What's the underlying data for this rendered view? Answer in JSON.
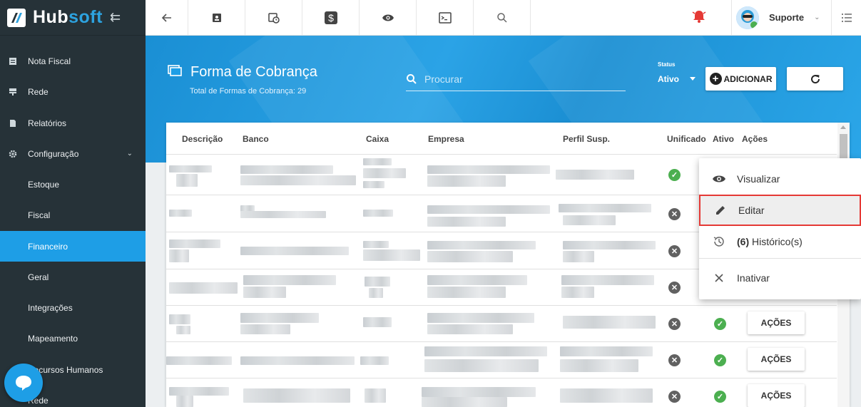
{
  "app": {
    "logo_word_a": "Hub",
    "logo_word_b": "soft"
  },
  "sidebar": {
    "items": [
      {
        "label": "Nota Fiscal",
        "icon": "document-icon"
      },
      {
        "label": "Rede",
        "icon": "network-icon"
      },
      {
        "label": "Relatórios",
        "icon": "report-icon"
      },
      {
        "label": "Configuração",
        "icon": "gear-icon"
      },
      {
        "label": "Estoque"
      },
      {
        "label": "Fiscal"
      },
      {
        "label": "Financeiro",
        "active": true
      },
      {
        "label": "Geral"
      },
      {
        "label": "Integrações"
      },
      {
        "label": "Mapeamento"
      },
      {
        "label": "Recursos Humanos"
      },
      {
        "label": "Rede"
      }
    ]
  },
  "topbar": {
    "user_name": "Suporte"
  },
  "header": {
    "title": "Forma de Cobrança",
    "subtitle": "Total de Formas de Cobrança: 29",
    "search_placeholder": "Procurar",
    "status_label": "Status",
    "status_value": "Ativo",
    "add_label": "ADICIONAR"
  },
  "table": {
    "columns": [
      "Descrição",
      "Banco",
      "Caixa",
      "Empresa",
      "Perfil Susp.",
      "Unificado",
      "Ativo",
      "Ações"
    ],
    "action_label": "AÇÕES",
    "rows": [
      {
        "unificado": true,
        "ativo": null
      },
      {
        "unificado": false,
        "ativo": null
      },
      {
        "unificado": false,
        "ativo": null
      },
      {
        "unificado": false,
        "ativo": null
      },
      {
        "unificado": false,
        "ativo": true
      },
      {
        "unificado": false,
        "ativo": true
      },
      {
        "unificado": false,
        "ativo": true
      }
    ]
  },
  "context_menu": {
    "view": "Visualizar",
    "edit": "Editar",
    "history_count": "(6)",
    "history": " Histórico(s)",
    "deactivate": "Inativar"
  },
  "colors": {
    "accent": "#1e9ee6",
    "sidebar": "#263238",
    "highlight_border": "#e53935"
  }
}
